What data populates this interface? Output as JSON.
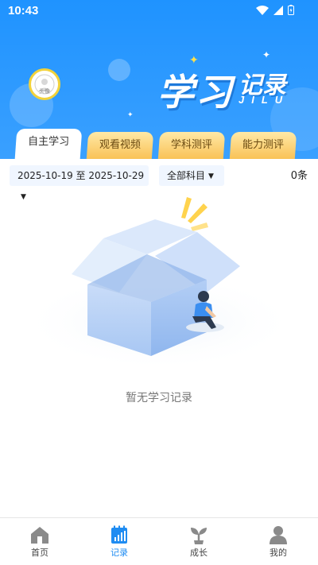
{
  "status": {
    "time": "10:43"
  },
  "header": {
    "avatar_label": "头像",
    "title_main": "学习",
    "title_sub": "记录",
    "title_pinyin": "JILU"
  },
  "tabs": [
    {
      "label": "自主学习",
      "active": true
    },
    {
      "label": "观看视频",
      "active": false
    },
    {
      "label": "学科测评",
      "active": false
    },
    {
      "label": "能力测评",
      "active": false
    }
  ],
  "filters": {
    "date_range": "2025-10-19 至 2025-10-29",
    "subject": "全部科目",
    "count": "0条"
  },
  "empty_state": {
    "message": "暂无学习记录"
  },
  "bottom_nav": [
    {
      "label": "首页",
      "icon": "home-icon",
      "active": false
    },
    {
      "label": "记录",
      "icon": "record-icon",
      "active": true
    },
    {
      "label": "成长",
      "icon": "sprout-icon",
      "active": false
    },
    {
      "label": "我的",
      "icon": "profile-icon",
      "active": false
    }
  ],
  "colors": {
    "header_blue": "#1f93ff",
    "tab_gold": "#f9c257",
    "active_blue": "#1f8cf2",
    "inactive_gray": "#8a8a8a"
  }
}
